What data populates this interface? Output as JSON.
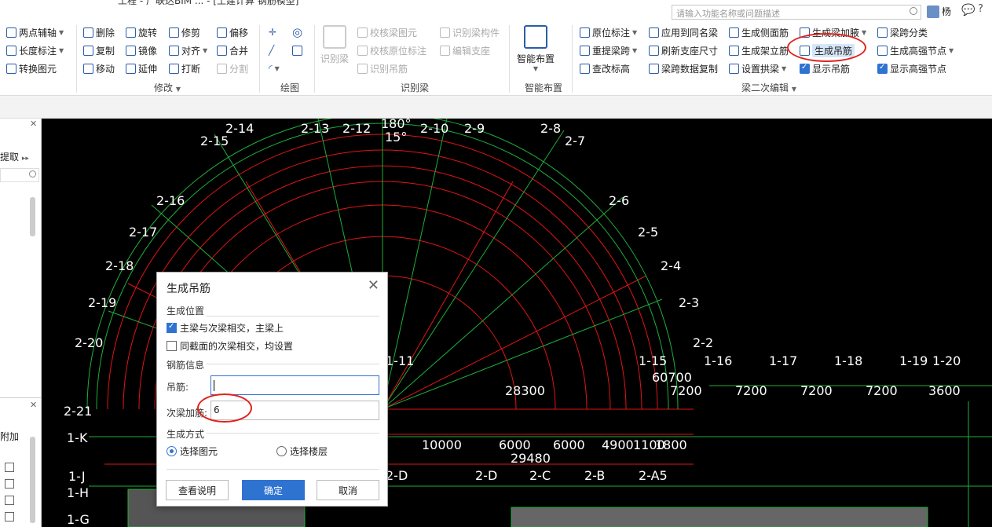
{
  "window": {
    "title": "工程 - 广联达BIM ... - [土建计算 钢筋模型]"
  },
  "search": {
    "placeholder": "请输入功能名称或问题描述"
  },
  "user": {
    "name": "杨"
  },
  "ribbon": {
    "group_axis": {
      "items": [
        "两点辅轴",
        "长度标注",
        "转换图元"
      ]
    },
    "group_modify": {
      "label": "修改",
      "items": [
        "删除",
        "旋转",
        "修剪",
        "偏移",
        "复制",
        "镜像",
        "对齐",
        "合并",
        "移动",
        "延伸",
        "打断",
        "分割"
      ]
    },
    "group_draw": {
      "label": "绘图"
    },
    "group_identify": {
      "label": "识别梁",
      "big_button": "识别梁",
      "items": [
        "校核梁图元",
        "识别梁构件",
        "校核原位标注",
        "编辑支座",
        "识别吊筋"
      ]
    },
    "group_smart": {
      "label": "智能布置",
      "big_button": "智能布置"
    },
    "group_beam_edit": {
      "label": "梁二次编辑",
      "items": [
        "原位标注",
        "应用到同名梁",
        "生成侧面筋",
        "生成梁加腋",
        "梁跨分类",
        "重提梁跨",
        "刷新支座尺寸",
        "生成架立筋",
        "生成吊筋",
        "生成高强节点",
        "查改标高",
        "梁跨数据复制",
        "设置拱梁",
        "显示吊筋",
        "显示高强节点"
      ]
    }
  },
  "left_panel": {
    "extract": "提取",
    "attach": "附加"
  },
  "cad": {
    "axis_labels_arc": [
      "2-14",
      "2-13",
      "2-12",
      "2-10",
      "2-9",
      "2-8",
      "2-7",
      "2-15",
      "2-16",
      "2-6",
      "2-17",
      "2-5",
      "2-18",
      "2-4",
      "2-19",
      "2-3",
      "2-20",
      "2-2",
      "2-21"
    ],
    "angle_top": "180°",
    "angle_15": "15°",
    "axis_labels_right": [
      "1-15",
      "1-16",
      "1-17",
      "1-18",
      "1-19",
      "1-20"
    ],
    "axis_labels_left": [
      "1-K",
      "1-J",
      "1-H",
      "1-G"
    ],
    "axis_labels_bottom": [
      "2-D",
      "2-D",
      "2-C",
      "2-B",
      "2-A5"
    ],
    "dims": [
      "28300",
      "60700",
      "7200",
      "7200",
      "7200",
      "7200",
      "3600",
      "10000",
      "6000",
      "6000",
      "4900",
      "1100",
      "1800",
      "29480"
    ],
    "axis_11": "1-11"
  },
  "dialog": {
    "title": "生成吊筋",
    "section_position": "生成位置",
    "opt_main": "主梁与次梁相交，主梁上",
    "opt_main_checked": true,
    "opt_same": "同截面的次梁相交，均设置",
    "opt_same_checked": false,
    "section_rebar": "钢筋信息",
    "hanger_label": "吊筋:",
    "hanger_value": "",
    "sub_label": "次梁加筋:",
    "sub_value": "6",
    "section_method": "生成方式",
    "radio_element": "选择图元",
    "radio_floor": "选择楼层",
    "radio_selected": "选择图元",
    "btn_help": "查看说明",
    "btn_ok": "确定",
    "btn_cancel": "取消"
  },
  "colors": {
    "accent": "#2f73d1",
    "annotation": "#e0221d",
    "cad_bg": "#000000"
  }
}
